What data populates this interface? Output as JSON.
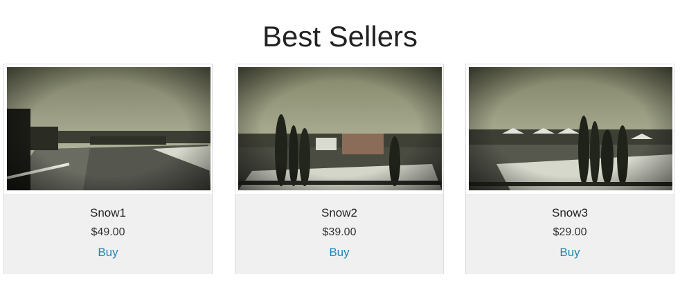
{
  "heading": "Best Sellers",
  "colors": {
    "link": "#1e86b8",
    "panel": "#f0f0f0",
    "border": "#dcdcdc"
  },
  "products": [
    {
      "name": "Snow1",
      "price": "$49.00",
      "buy_label": "Buy",
      "image": "snowy-road-photo"
    },
    {
      "name": "Snow2",
      "price": "$39.00",
      "buy_label": "Buy",
      "image": "snowy-courtyard-cypress-photo"
    },
    {
      "name": "Snow3",
      "price": "$29.00",
      "buy_label": "Buy",
      "image": "snowy-park-gazebos-photo"
    }
  ]
}
